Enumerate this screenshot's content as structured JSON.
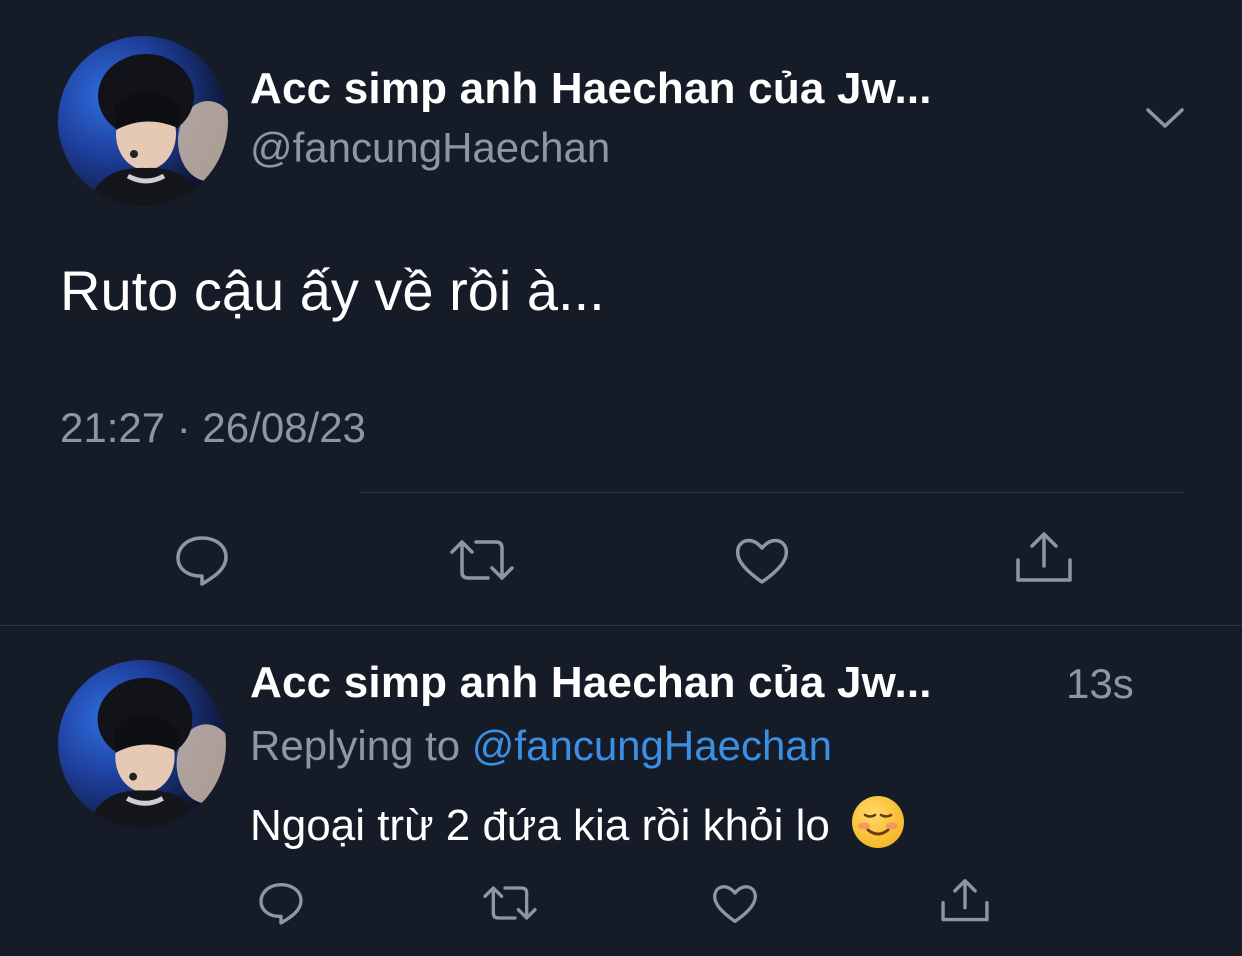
{
  "main_tweet": {
    "display_name": "Acc simp anh Haechan của Jw...",
    "handle": "@fancungHaechan",
    "text": "Ruto cậu ấy về rồi à...",
    "timestamp": "21:27 · 26/08/23",
    "icons": {
      "menu": "chevron-down-icon",
      "actions": [
        "reply-icon",
        "retweet-icon",
        "like-icon",
        "share-icon"
      ]
    }
  },
  "reply_tweet": {
    "display_name": "Acc simp anh Haechan của Jw...",
    "time_ago": "13s",
    "replying_prefix": "Replying to ",
    "replying_handle": "@fancungHaechan",
    "text": "Ngoại trừ 2 đứa kia rồi khỏi lo",
    "emoji": "smiling-face-with-blush-emoji",
    "icons": {
      "actions": [
        "reply-icon",
        "retweet-icon",
        "like-icon",
        "share-icon"
      ]
    }
  },
  "colors": {
    "background": "#151c27",
    "primary_text": "#ffffff",
    "secondary_text": "#8b97a6",
    "link": "#3b8fe4",
    "divider": "#2c3440"
  }
}
